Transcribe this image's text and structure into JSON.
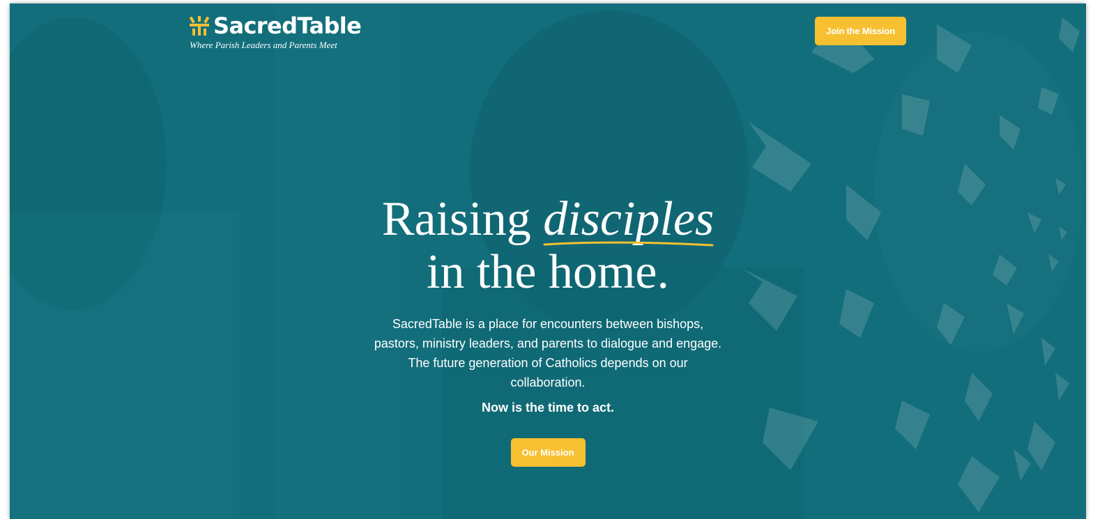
{
  "brand": {
    "name": "SacredTable",
    "tagline": "Where Parish Leaders and Parents Meet"
  },
  "nav": {
    "join_label": "Join the Mission"
  },
  "hero": {
    "headline_part1": "Raising ",
    "headline_highlight": "disciples",
    "headline_part2": "in the home.",
    "description": "SacredTable is a place for encounters between bishops, pastors, ministry leaders, and parents to dialogue and engage. The future generation of Catholics depends on our collaboration.",
    "call_to_action": "Now is the time to act.",
    "button_label": "Our Mission"
  },
  "colors": {
    "teal_overlay": "#136e7b",
    "accent_yellow": "#f7c031",
    "text": "#ffffff"
  },
  "icons": {
    "brand_mark": "sacred-table-logo-icon",
    "background_pattern": "chevron-arrows-pattern"
  }
}
